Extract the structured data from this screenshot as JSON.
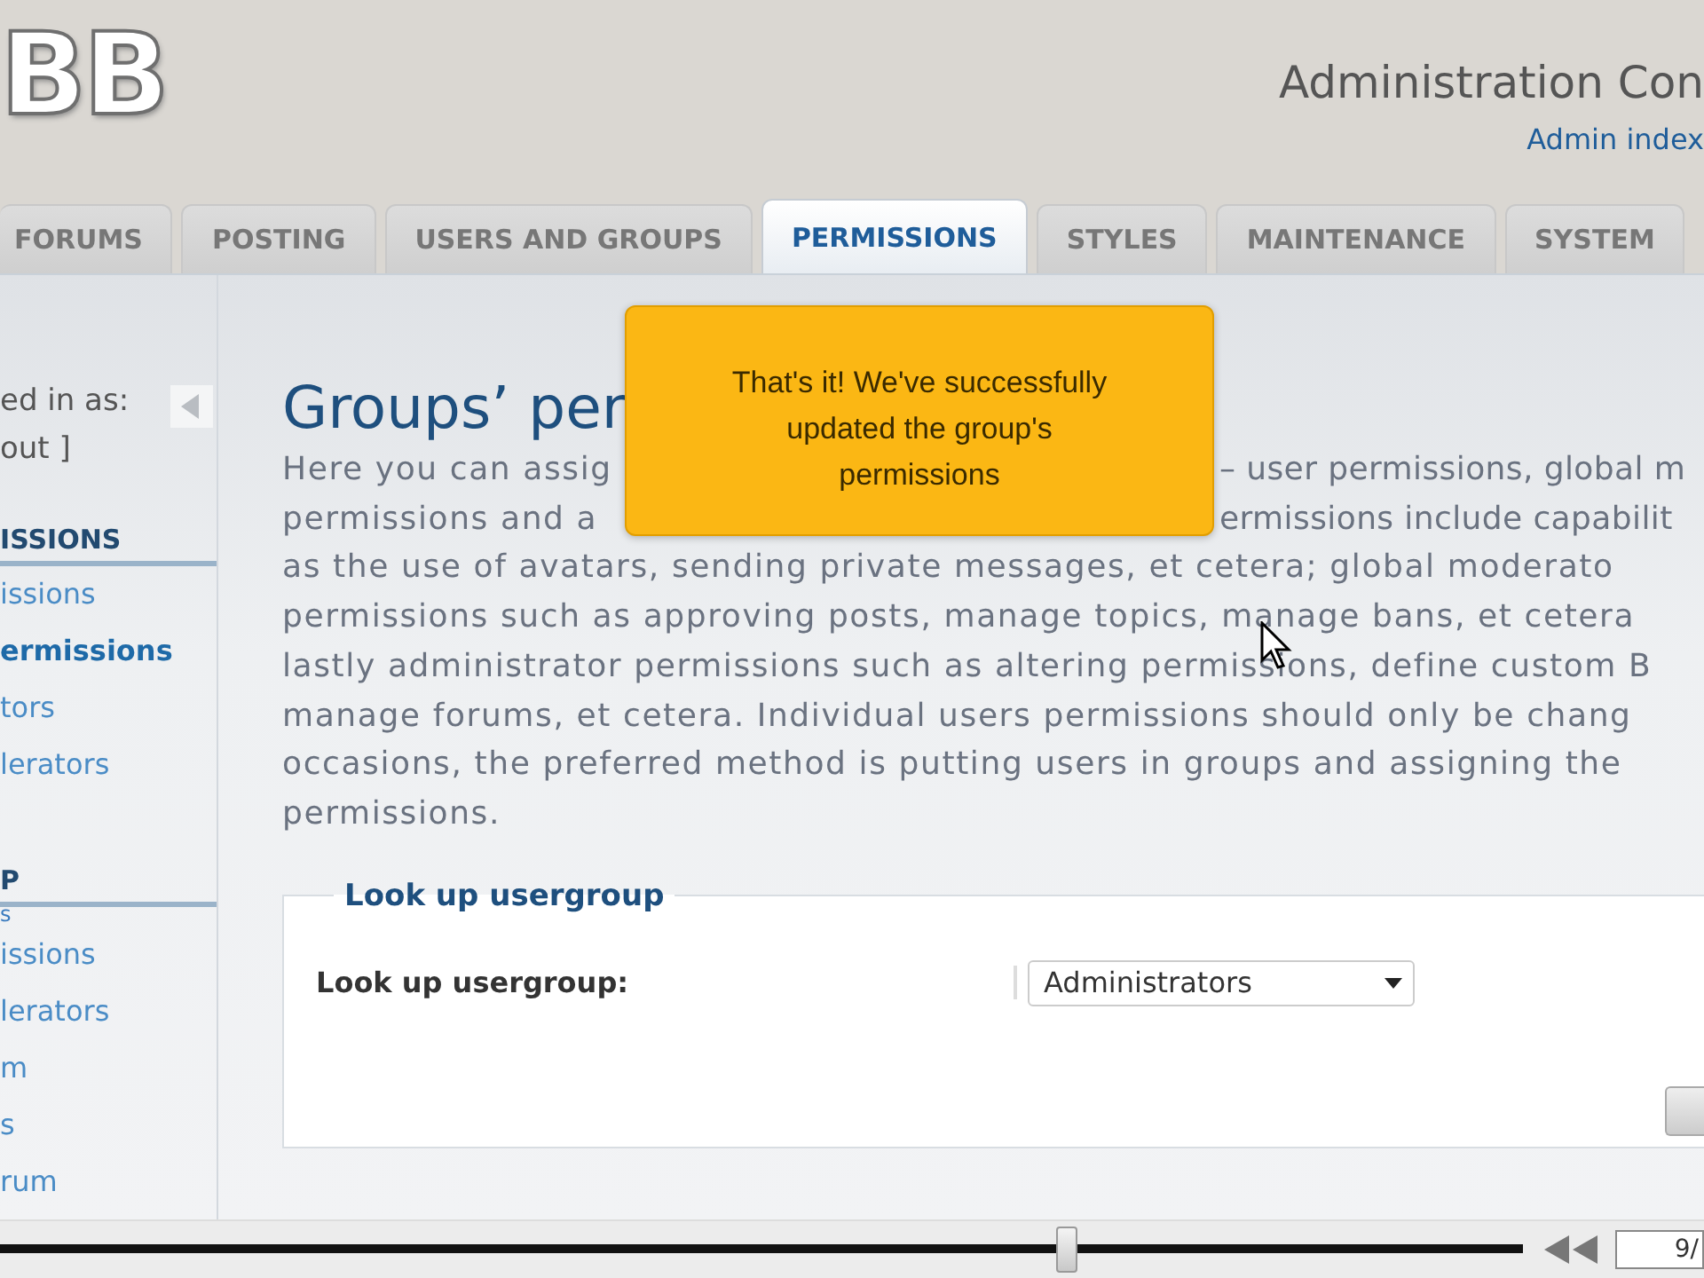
{
  "header": {
    "logo_text": "BB",
    "title": "Administration Con",
    "link": "Admin index"
  },
  "tabs": [
    {
      "label": "FORUMS",
      "selected": false
    },
    {
      "label": "POSTING",
      "selected": false
    },
    {
      "label": "USERS AND GROUPS",
      "selected": false
    },
    {
      "label": "PERMISSIONS",
      "selected": true
    },
    {
      "label": "STYLES",
      "selected": false
    },
    {
      "label": "MAINTENANCE",
      "selected": false
    },
    {
      "label": "SYSTEM",
      "selected": false
    }
  ],
  "sidebar": {
    "user_lines": [
      "ed in as:",
      "out ]"
    ],
    "sections": [
      {
        "heading": "ISSIONS",
        "items": [
          {
            "label": "issions",
            "selected": false
          },
          {
            "label": "ermissions",
            "selected": true
          },
          {
            "label": "tors",
            "selected": false
          },
          {
            "label": "lerators",
            "selected": false
          }
        ]
      },
      {
        "heading": "P",
        "subheading": "s",
        "items": [
          {
            "label": "issions",
            "selected": false
          },
          {
            "label": "lerators",
            "selected": false
          },
          {
            "label": "m",
            "selected": false
          },
          {
            "label": "s",
            "selected": false
          },
          {
            "label": "rum",
            "selected": false
          }
        ]
      }
    ]
  },
  "page": {
    "title": "Groups’ per",
    "intro_lines": [
      {
        "parts": [
          "Here you can assig",
          "– user permissions, global m"
        ]
      },
      {
        "parts": [
          "permissions and a",
          "ermissions include capabilit"
        ]
      },
      {
        "parts": [
          "as the use of avatars, sending private messages, et cetera; global moderato"
        ]
      },
      {
        "parts": [
          "permissions such as approving posts, manage topics, manage bans, et cetera"
        ]
      },
      {
        "parts": [
          "lastly administrator permissions such as altering permissions, define custom B"
        ]
      },
      {
        "parts": [
          "manage forums, et cetera. Individual users permissions should only be chang"
        ]
      },
      {
        "parts": [
          "occasions, the preferred method is putting users in groups and assigning the"
        ]
      },
      {
        "parts": [
          "permissions."
        ]
      }
    ],
    "fieldset": {
      "legend": "Look up usergroup",
      "label": "Look up usergroup:",
      "value": "Administrators"
    }
  },
  "tooltip": {
    "text": "That's it! We've successfully updated the group's permissions"
  },
  "player": {
    "level": 0.7,
    "time": "9/"
  }
}
